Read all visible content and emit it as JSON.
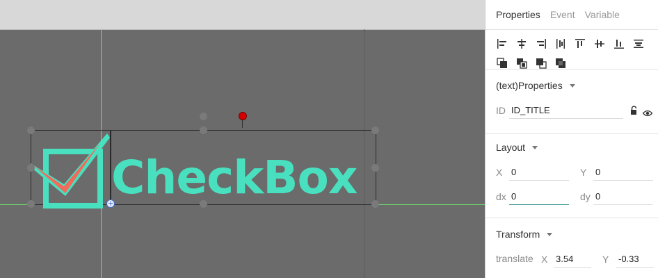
{
  "canvas": {
    "logo_text": "CheckBox",
    "colors": {
      "logo_teal": "#49e0c0",
      "check_red": "#ef6b5b",
      "guide_green": "#6fe06f",
      "pin_red": "#d40000"
    }
  },
  "panel": {
    "tabs": [
      {
        "label": "Properties",
        "active": true
      },
      {
        "label": "Event",
        "active": false
      },
      {
        "label": "Variable",
        "active": false
      }
    ],
    "toolbar_icons": [
      "align-left-icon",
      "align-center-h-icon",
      "align-right-icon",
      "distribute-h-icon",
      "align-top-icon",
      "align-center-v-icon",
      "align-bottom-icon",
      "distribute-v-icon",
      "bring-to-front-icon",
      "bring-forward-icon",
      "send-backward-icon",
      "send-to-back-icon"
    ],
    "text_props": {
      "title": "(text)Properties",
      "id_label": "ID",
      "id_value": "ID_TITLE",
      "icons": [
        "lock-icon",
        "eye-icon"
      ]
    },
    "layout": {
      "title": "Layout",
      "x_label": "X",
      "x_value": "0",
      "y_label": "Y",
      "y_value": "0",
      "dx_label": "dx",
      "dx_value": "0",
      "dy_label": "dy",
      "dy_value": "0"
    },
    "transform": {
      "title": "Transform",
      "translate_label": "translate",
      "x_label": "X",
      "x_value": "3.54",
      "y_label": "Y",
      "y_value": "-0.33"
    }
  }
}
